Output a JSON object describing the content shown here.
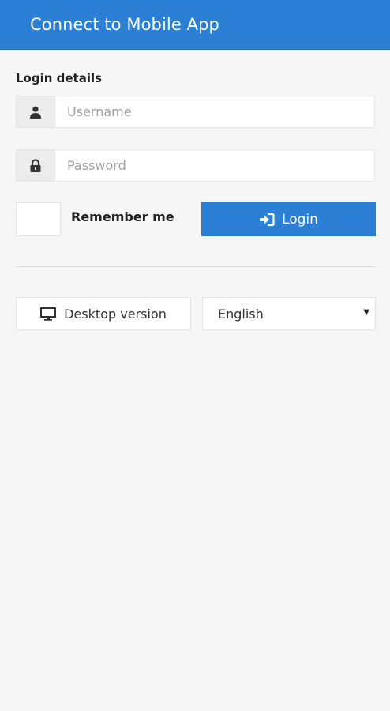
{
  "header": {
    "title": "Connect to Mobile App",
    "color": "#2b7fd4"
  },
  "form": {
    "section_label": "Login details",
    "username": {
      "placeholder": "Username",
      "value": "",
      "icon": "user-icon"
    },
    "password": {
      "placeholder": "Password",
      "value": "",
      "icon": "lock-icon"
    },
    "remember_label": "Remember me",
    "login_button": {
      "label": "Login",
      "icon": "sign-in-icon",
      "color": "#2b7fd4"
    }
  },
  "footer": {
    "desktop_button": {
      "label": "Desktop version",
      "icon": "monitor-icon"
    },
    "language": {
      "selected": "English"
    }
  }
}
